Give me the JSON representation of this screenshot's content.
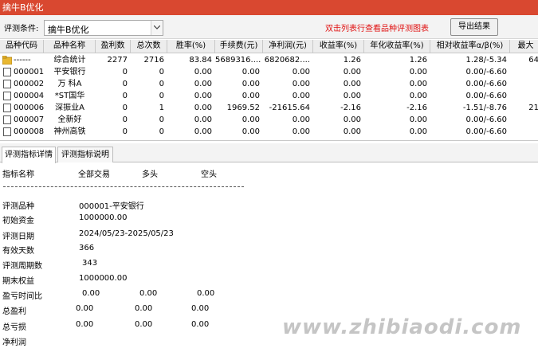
{
  "window": {
    "title": "擒牛B优化"
  },
  "toolbar": {
    "label": "评测条件:",
    "combo_value": "擒牛B优化",
    "hint": "双击列表行查看品种评测图表",
    "export_label": "导出结果"
  },
  "grid": {
    "columns": [
      "品种代码",
      "品种名称",
      "盈利数",
      "总次数",
      "胜率(%)",
      "手续费(元)",
      "净利润(元)",
      "收益率(%)",
      "年化收益率(%)",
      "相对收益率α/β(%)",
      "最大"
    ],
    "rows": [
      [
        "------",
        "综合统计",
        "2277",
        "2716",
        "83.84",
        "5689316....",
        "6820682....",
        "1.26",
        "1.26",
        "1.28/-5.34",
        "64"
      ],
      [
        "000001",
        "平安银行",
        "0",
        "0",
        "0.00",
        "0.00",
        "0.00",
        "0.00",
        "0.00",
        "0.00/-6.60",
        ""
      ],
      [
        "000002",
        "万 科A",
        "0",
        "0",
        "0.00",
        "0.00",
        "0.00",
        "0.00",
        "0.00",
        "0.00/-6.60",
        ""
      ],
      [
        "000004",
        "*ST国华",
        "0",
        "0",
        "0.00",
        "0.00",
        "0.00",
        "0.00",
        "0.00",
        "0.00/-6.60",
        ""
      ],
      [
        "000006",
        "深振业A",
        "0",
        "1",
        "0.00",
        "1969.52",
        "-21615.64",
        "-2.16",
        "-2.16",
        "-1.51/-8.76",
        "21"
      ],
      [
        "000007",
        "全新好",
        "0",
        "0",
        "0.00",
        "0.00",
        "0.00",
        "0.00",
        "0.00",
        "0.00/-6.60",
        ""
      ],
      [
        "000008",
        "神州高铁",
        "0",
        "0",
        "0.00",
        "0.00",
        "0.00",
        "0.00",
        "0.00",
        "0.00/-6.60",
        ""
      ]
    ]
  },
  "tabs": [
    {
      "label": "评测指标详情"
    },
    {
      "label": "评测指标说明"
    }
  ],
  "detail": {
    "header": {
      "name": "指标名称",
      "all": "全部交易",
      "long": "多头",
      "short": "空头"
    },
    "fields": [
      {
        "label": "评测品种",
        "value": "000001-平安银行"
      },
      {
        "label": "初始资金",
        "value": "1000000.00"
      },
      {
        "label": "评测日期",
        "value": "2024/05/23-2025/05/23"
      },
      {
        "label": "有效天数",
        "value": "366"
      },
      {
        "label": "评测周期数",
        "value": "343"
      },
      {
        "label": "期末权益",
        "value": "1000000.00"
      }
    ],
    "metrics": [
      {
        "label": "盈亏时间比",
        "all": "0.00",
        "long": "0.00",
        "short": "0.00"
      },
      {
        "label": "总盈利",
        "all": "0.00",
        "long": "0.00",
        "short": "0.00"
      },
      {
        "label": "总亏损",
        "all": "0.00",
        "long": "0.00",
        "short": "0.00"
      },
      {
        "label": "净利润",
        "all": "",
        "long": "",
        "short": ""
      }
    ]
  },
  "watermark": "www.zhibiaodi.com",
  "colors": {
    "titlebar": "#d94830",
    "hint": "#e01010"
  }
}
